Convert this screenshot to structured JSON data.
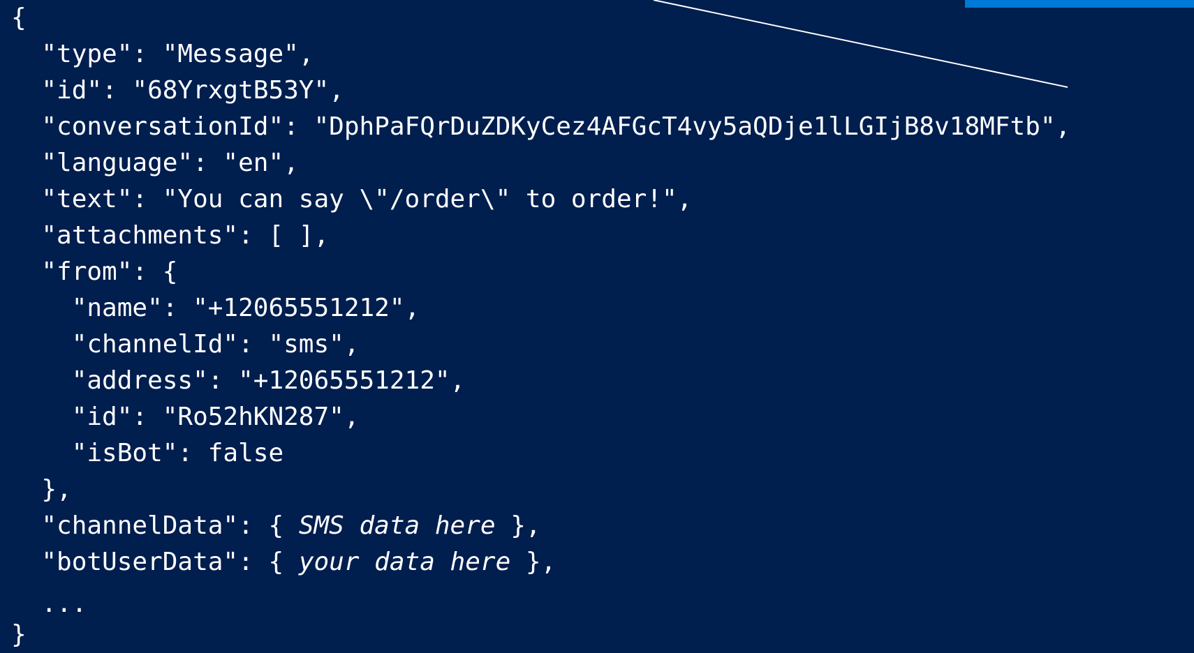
{
  "colors": {
    "background": "#001e4e",
    "text": "#ffffff",
    "accent": "#0078d7"
  },
  "code": {
    "open_brace": "{",
    "lines": {
      "type": "  \"type\": \"Message\",",
      "id": "  \"id\": \"68YrxgtB53Y\",",
      "conversationId": "  \"conversationId\": \"DphPaFQrDuZDKyCez4AFGcT4vy5aQDje1lLGIjB8v18MFtb\",",
      "language": "  \"language\": \"en\",",
      "text": "  \"text\": \"You can say \\\"/order\\\" to order!\",",
      "attachments": "  \"attachments\": [ ],",
      "from_open": "  \"from\": {",
      "from_name": "    \"name\": \"+12065551212\",",
      "from_channelId": "    \"channelId\": \"sms\",",
      "from_address": "    \"address\": \"+12065551212\",",
      "from_id": "    \"id\": \"Ro52hKN287\",",
      "from_isBot": "    \"isBot\": false",
      "from_close": "  },",
      "channelData_key": "  \"channelData\": { ",
      "channelData_placeholder": "SMS data here",
      "channelData_close": " },",
      "botUserData_key": "  \"botUserData\": { ",
      "botUserData_placeholder": "your data here",
      "botUserData_close": " },",
      "ellipsis": "  ..."
    },
    "close_brace": "}"
  }
}
